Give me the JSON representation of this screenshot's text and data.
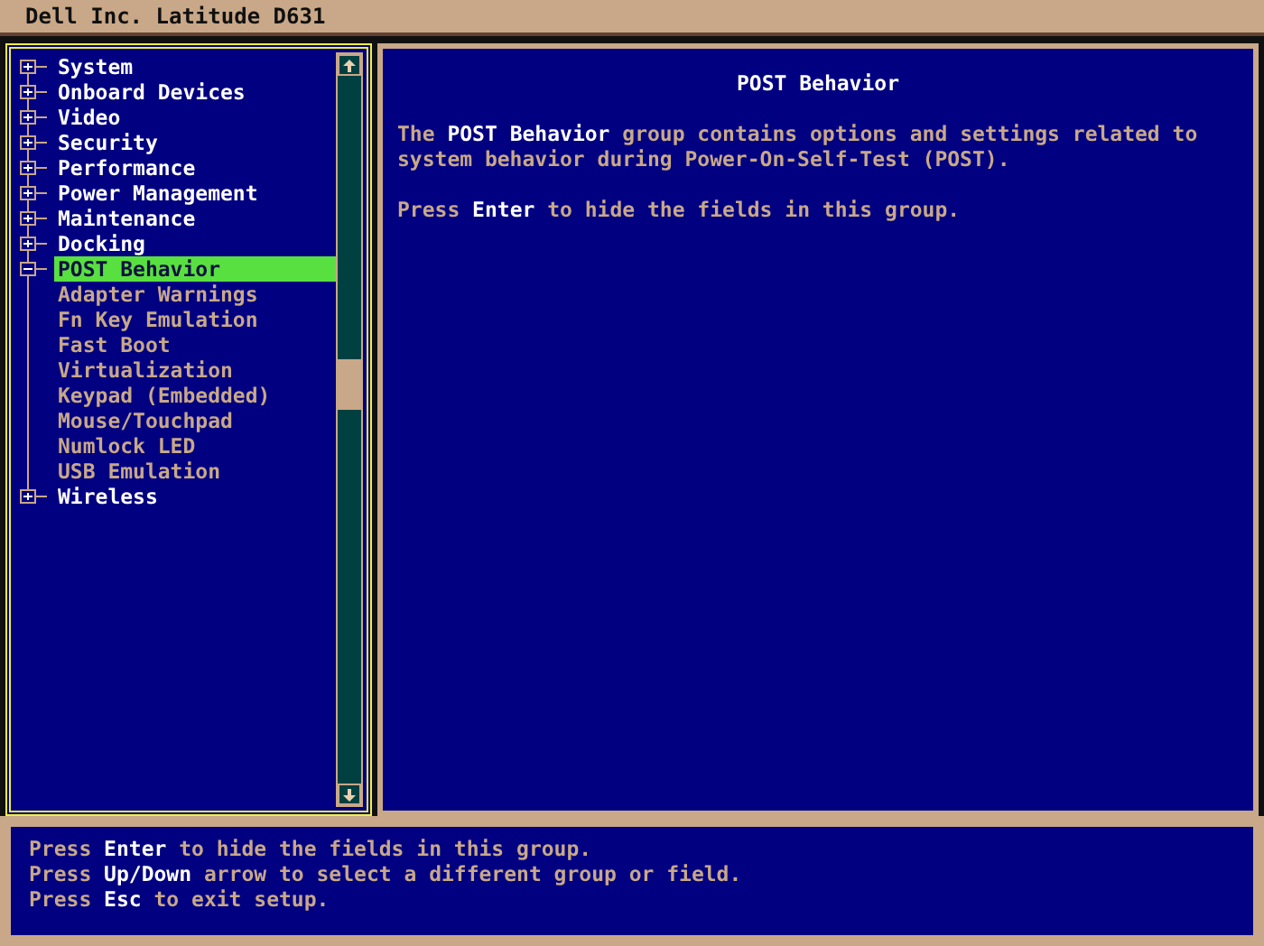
{
  "window": {
    "title": "Dell Inc. Latitude D631"
  },
  "tree": [
    {
      "label": "System",
      "expanded": false,
      "selected": false
    },
    {
      "label": "Onboard Devices",
      "expanded": false,
      "selected": false
    },
    {
      "label": "Video",
      "expanded": false,
      "selected": false
    },
    {
      "label": "Security",
      "expanded": false,
      "selected": false
    },
    {
      "label": "Performance",
      "expanded": false,
      "selected": false
    },
    {
      "label": "Power Management",
      "expanded": false,
      "selected": false
    },
    {
      "label": "Maintenance",
      "expanded": false,
      "selected": false
    },
    {
      "label": "Docking",
      "expanded": false,
      "selected": false
    },
    {
      "label": "POST Behavior",
      "expanded": true,
      "selected": true,
      "children": [
        {
          "label": "Adapter Warnings",
          "selected": false
        },
        {
          "label": "Fn Key Emulation",
          "selected": false
        },
        {
          "label": "Fast Boot",
          "selected": false
        },
        {
          "label": "Virtualization",
          "selected": false
        },
        {
          "label": "Keypad (Embedded)",
          "selected": false
        },
        {
          "label": "Mouse/Touchpad",
          "selected": false
        },
        {
          "label": "Numlock LED",
          "selected": false
        },
        {
          "label": "USB Emulation",
          "selected": false
        }
      ]
    },
    {
      "label": "Wireless",
      "expanded": false,
      "selected": false
    }
  ],
  "detail": {
    "heading": "POST Behavior",
    "paragraphs": [
      "The **POST Behavior** group contains options and settings related to system behavior during Power-On-Self-Test (POST).",
      "Press **Enter** to hide the fields in this group."
    ]
  },
  "help": [
    "Press **Enter** to hide the fields in this group.",
    "Press **Up/Down** arrow to select a different group or field.",
    "Press **Esc** to exit setup."
  ]
}
